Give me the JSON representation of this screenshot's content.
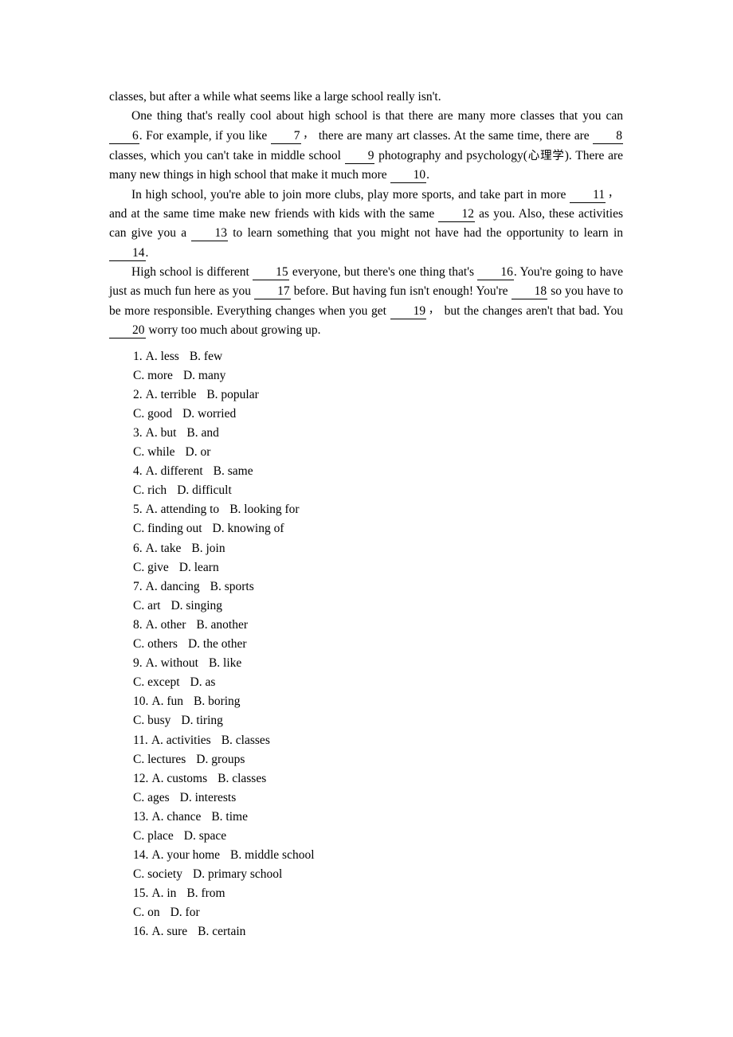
{
  "document": {
    "type": "cloze-test-worksheet",
    "passage": {
      "paragraphs": [
        {
          "indent": false,
          "runs": [
            {
              "kind": "text",
              "text": "classes, but after a while what seems like a large school really isn't."
            }
          ]
        },
        {
          "indent": true,
          "runs": [
            {
              "kind": "text",
              "text": "One thing that's really cool about high school is that there are many more classes that you can "
            },
            {
              "kind": "blank",
              "number": "6"
            },
            {
              "kind": "text",
              "text": ". For example, if you like "
            },
            {
              "kind": "blank",
              "number": "7"
            },
            {
              "kind": "cncomma",
              "text": "，"
            },
            {
              "kind": "text",
              "text": "there are many art classes. At the same time, there are "
            },
            {
              "kind": "blank",
              "number": "8"
            },
            {
              "kind": "text",
              "text": " classes, which you can't take in middle school "
            },
            {
              "kind": "blank",
              "number": "9"
            },
            {
              "kind": "text",
              "text": " photography and psychology("
            },
            {
              "kind": "cn",
              "text": "心理学"
            },
            {
              "kind": "text",
              "text": "). There are many new things in high school that make it much more "
            },
            {
              "kind": "blank",
              "number": "10"
            },
            {
              "kind": "text",
              "text": "."
            }
          ]
        },
        {
          "indent": true,
          "runs": [
            {
              "kind": "text",
              "text": "In high school, you're able to join more clubs, play more sports, and take part in more "
            },
            {
              "kind": "blank",
              "number": "11"
            },
            {
              "kind": "cncomma",
              "text": "，"
            },
            {
              "kind": "text",
              "text": "and at the same time make new friends with kids with the same "
            },
            {
              "kind": "blank",
              "number": "12"
            },
            {
              "kind": "text",
              "text": " as you. Also, these activities can give you a "
            },
            {
              "kind": "blank",
              "number": "13"
            },
            {
              "kind": "text",
              "text": " to learn something that you might not have had the opportunity to learn in "
            },
            {
              "kind": "blank",
              "number": "14"
            },
            {
              "kind": "text",
              "text": "."
            }
          ]
        },
        {
          "indent": true,
          "runs": [
            {
              "kind": "text",
              "text": "High school is different "
            },
            {
              "kind": "blank",
              "number": "15"
            },
            {
              "kind": "text",
              "text": " everyone, but there's one thing that's "
            },
            {
              "kind": "blank",
              "number": "16"
            },
            {
              "kind": "text",
              "text": ". You're going to have just as much fun here as you "
            },
            {
              "kind": "blank",
              "number": "17"
            },
            {
              "kind": "text",
              "text": " before. But having fun isn't enough! You're "
            },
            {
              "kind": "blank",
              "number": "18"
            },
            {
              "kind": "text",
              "text": " so you have to be more responsible. Everything changes when you get "
            },
            {
              "kind": "blank",
              "number": "19"
            },
            {
              "kind": "cncomma",
              "text": "，"
            },
            {
              "kind": "text",
              "text": "but the changes aren't that bad. You "
            },
            {
              "kind": "blank",
              "number": "20"
            },
            {
              "kind": "text",
              "text": " worry too much about growing up."
            }
          ]
        }
      ]
    },
    "questions": [
      {
        "number": "1.",
        "line1": [
          "A. less",
          "B. few"
        ],
        "line2": [
          "C. more",
          "D. many"
        ]
      },
      {
        "number": "2.",
        "line1": [
          "A. terrible",
          "B. popular"
        ],
        "line2": [
          "C. good",
          "D. worried"
        ]
      },
      {
        "number": "3.",
        "line1": [
          "A. but",
          "B. and"
        ],
        "line2": [
          "C. while",
          "D. or"
        ]
      },
      {
        "number": "4.",
        "line1": [
          "A. different",
          "B. same"
        ],
        "line2": [
          "C. rich",
          "D. difficult"
        ]
      },
      {
        "number": "5.",
        "line1": [
          "A. attending to",
          "B. looking for"
        ],
        "line2": [
          "C. finding out",
          "D. knowing of"
        ]
      },
      {
        "number": "6.",
        "line1": [
          "A. take",
          "B. join"
        ],
        "line2": [
          "C. give",
          "D. learn"
        ]
      },
      {
        "number": "7.",
        "line1": [
          "A. dancing",
          "B. sports"
        ],
        "line2": [
          "C. art",
          "D. singing"
        ]
      },
      {
        "number": "8.",
        "line1": [
          "A. other",
          "B. another"
        ],
        "line2": [
          "C. others",
          "D. the other"
        ]
      },
      {
        "number": "9.",
        "line1": [
          "A. without",
          "B. like"
        ],
        "line2": [
          "C. except",
          "D. as"
        ]
      },
      {
        "number": "10.",
        "line1": [
          "A. fun",
          "B. boring"
        ],
        "line2": [
          "C. busy",
          "D. tiring"
        ]
      },
      {
        "number": "11.",
        "line1": [
          "A. activities",
          "B. classes"
        ],
        "line2": [
          "C. lectures",
          "D. groups"
        ]
      },
      {
        "number": "12.",
        "line1": [
          "A. customs",
          "B. classes"
        ],
        "line2": [
          "C. ages",
          "D. interests"
        ]
      },
      {
        "number": "13.",
        "line1": [
          "A. chance",
          "B. time"
        ],
        "line2": [
          "C. place",
          "D. space"
        ]
      },
      {
        "number": "14.",
        "line1": [
          "A. your home",
          "B. middle school"
        ],
        "line2": [
          "C. society",
          "D. primary school"
        ]
      },
      {
        "number": "15.",
        "line1": [
          "A. in",
          "B. from"
        ],
        "line2": [
          "C. on",
          "D. for"
        ]
      },
      {
        "number": "16.",
        "line1": [
          "A. sure",
          "B. certain"
        ],
        "line2": []
      }
    ]
  }
}
